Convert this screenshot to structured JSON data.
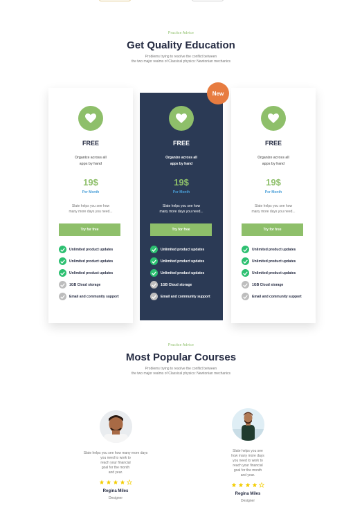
{
  "pricing": {
    "eyebrow": "Practice Advice",
    "title": "Get Quality Education",
    "subtitle_line1": "Problems trying to resolve the conflict between",
    "subtitle_line2": "the two major realms of Classical physics: Newtonian mechanics",
    "badge": "New",
    "plans": [
      {
        "name": "FREE",
        "desc_line1": "Organize across all",
        "desc_line2": "apps by hand",
        "price": "19$",
        "period": "Per Month",
        "note_line1": "Slate helps you see how",
        "note_line2": "many more days you need...",
        "button": "Try for free",
        "features": [
          "Unlimited product updates",
          "Unlimited product updates",
          "Unlimited product updates",
          "1GB  Cloud storage",
          "Email and community support"
        ]
      },
      {
        "name": "FREE",
        "desc_line1": "Organize across all",
        "desc_line2": "apps by hand",
        "price": "19$",
        "period": "Per Month",
        "note_line1": "Slate helps you see how",
        "note_line2": "many more days you need...",
        "button": "Try for free",
        "features": [
          "Unlimited product updates",
          "Unlimited product updates",
          "Unlimited product updates",
          "1GB  Cloud storage",
          "Email and community support"
        ]
      },
      {
        "name": "FREE",
        "desc_line1": "Organize across all",
        "desc_line2": "apps by hand",
        "price": "19$",
        "period": "Per Month",
        "note_line1": "Slate helps you see how",
        "note_line2": "many more days you need...",
        "button": "Try for free",
        "features": [
          "Unlimited product updates",
          "Unlimited product updates",
          "Unlimited product updates",
          "1GB  Cloud storage",
          "Email and community support"
        ]
      }
    ]
  },
  "courses": {
    "eyebrow": "Practice Advice",
    "title": "Most Popular Courses",
    "subtitle_line1": "Problems trying to resolve the conflict between",
    "subtitle_line2": "the two major realms of Classical physics: Newtonian mechanics",
    "testimonials": [
      {
        "quote_lines": [
          "Slate helps you see  how many more days",
          "you need to work to",
          "reach your financial",
          "goal for the month",
          "and year."
        ],
        "rating": 4,
        "name": "Regina Miles",
        "role": "Designer"
      },
      {
        "quote_lines": [
          "Slate helps you see",
          "how many more days",
          "you need to work to",
          "reach your financial",
          "goal for the month",
          "and year."
        ],
        "rating": 4,
        "name": "Regina Miles",
        "role": "Designer"
      }
    ]
  },
  "colors": {
    "accent_green": "#8ebf6a",
    "dark_card": "#2b3a55",
    "badge_orange": "#e77c40",
    "check_green": "#2dc071",
    "check_grey": "#bdbdbd",
    "star_yellow": "#f3cd03",
    "period_blue": "#4a9fd8"
  },
  "icons": {
    "plan_icon": "heart-icon",
    "feature_included": "check-circle-icon",
    "feature_excluded": "check-circle-grey-icon",
    "rating": "star-icon"
  }
}
